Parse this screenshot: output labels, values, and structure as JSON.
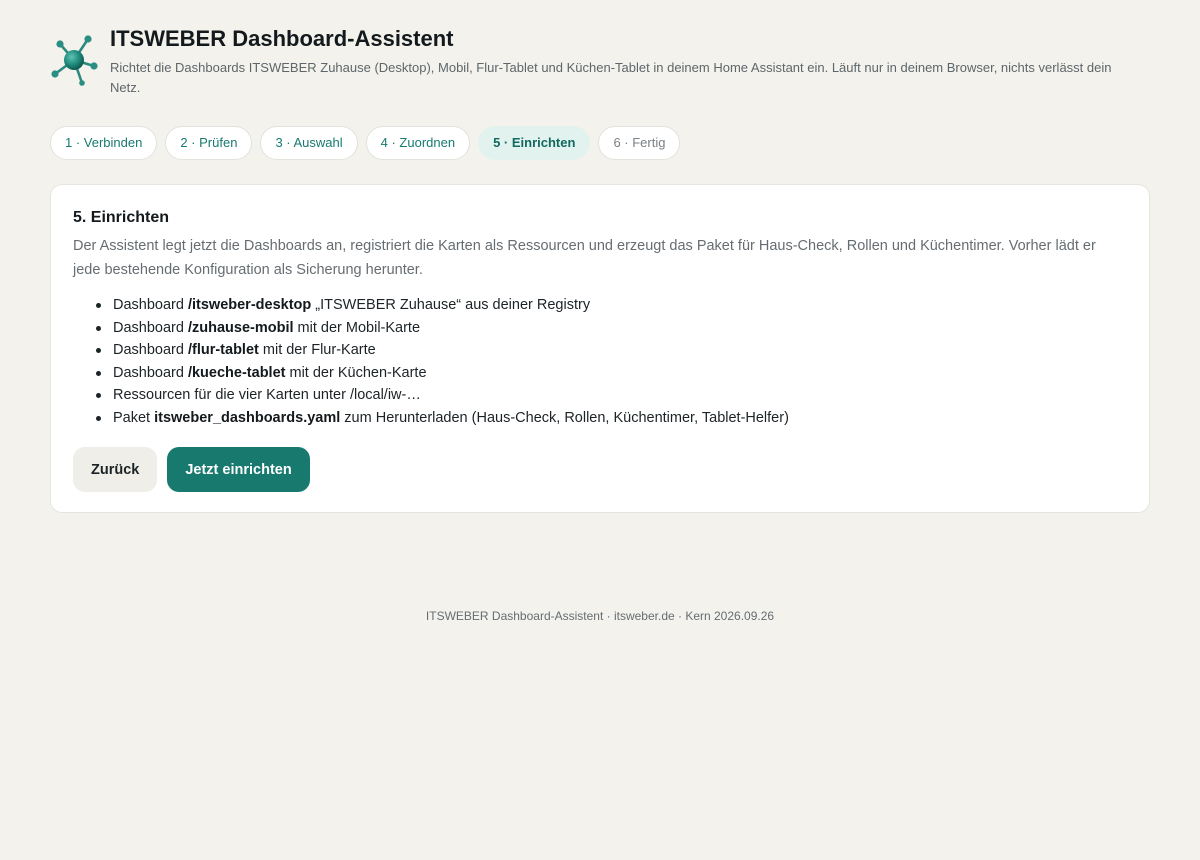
{
  "header": {
    "title": "ITSWEBER Dashboard-Assistent",
    "subtitle": "Richtet die Dashboards ITSWEBER Zuhause (Desktop), Mobil, Flur-Tablet und Küchen-Tablet in deinem Home Assistant ein. Läuft nur in deinem Browser, nichts verlässt dein Netz.",
    "logo_icon": "molecule-network-icon"
  },
  "steps": [
    {
      "label": "1 · Verbinden",
      "state": "done"
    },
    {
      "label": "2 · Prüfen",
      "state": "done"
    },
    {
      "label": "3 · Auswahl",
      "state": "done"
    },
    {
      "label": "4 · Zuordnen",
      "state": "done"
    },
    {
      "label": "5 · Einrichten",
      "state": "active"
    },
    {
      "label": "6 · Fertig",
      "state": "future"
    }
  ],
  "card": {
    "title": "5. Einrichten",
    "description": "Der Assistent legt jetzt die Dashboards an, registriert die Karten als Ressourcen und erzeugt das Paket für Haus-Check, Rollen und Küchentimer. Vorher lädt er jede bestehende Konfiguration als Sicherung herunter.",
    "items": [
      {
        "prefix": "Dashboard ",
        "strong": "/itsweber-desktop",
        "suffix": " „ITSWEBER Zuhause“ aus deiner Registry"
      },
      {
        "prefix": "Dashboard ",
        "strong": "/zuhause-mobil",
        "suffix": " mit der Mobil-Karte"
      },
      {
        "prefix": "Dashboard ",
        "strong": "/flur-tablet",
        "suffix": " mit der Flur-Karte"
      },
      {
        "prefix": "Dashboard ",
        "strong": "/kueche-tablet",
        "suffix": " mit der Küchen-Karte"
      },
      {
        "prefix": "Ressourcen für die vier Karten unter /local/iw-…",
        "strong": "",
        "suffix": ""
      },
      {
        "prefix": "Paket ",
        "strong": "itsweber_dashboards.yaml",
        "suffix": " zum Herunterladen (Haus-Check, Rollen, Küchentimer, Tablet-Helfer)"
      }
    ],
    "back_label": "Zurück",
    "submit_label": "Jetzt einrichten"
  },
  "footer": {
    "text": "ITSWEBER Dashboard-Assistent · itsweber.de · Kern 2026.09.26"
  },
  "colors": {
    "background": "#f3f2ec",
    "accent": "#187a6f",
    "active_step_bg": "#e2f3ef"
  }
}
